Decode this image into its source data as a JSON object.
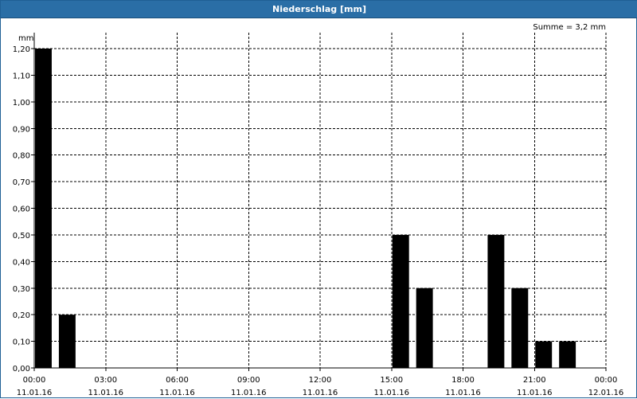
{
  "window": {
    "title": "Niederschlag [mm]"
  },
  "chart_data": {
    "type": "bar",
    "title": "Niederschlag [mm]",
    "unit_label": "mm",
    "sum_label": "Summe = 3,2 mm",
    "ylim": [
      0,
      1.2
    ],
    "y_ticks": [
      "0,00",
      "0,10",
      "0,20",
      "0,30",
      "0,40",
      "0,50",
      "0,60",
      "0,70",
      "0,80",
      "0,90",
      "1,00",
      "1,10",
      "1,20"
    ],
    "x_ticks": [
      {
        "time": "00:00",
        "date": "11.01.16"
      },
      {
        "time": "03:00",
        "date": "11.01.16"
      },
      {
        "time": "06:00",
        "date": "11.01.16"
      },
      {
        "time": "09:00",
        "date": "11.01.16"
      },
      {
        "time": "12:00",
        "date": "11.01.16"
      },
      {
        "time": "15:00",
        "date": "11.01.16"
      },
      {
        "time": "18:00",
        "date": "11.01.16"
      },
      {
        "time": "21:00",
        "date": "11.01.16"
      },
      {
        "time": "00:00",
        "date": "12.01.16"
      }
    ],
    "grid": true,
    "bar_color": "#000000",
    "bars": [
      {
        "start": "00:00",
        "end": "01:00",
        "value": 1.2
      },
      {
        "start": "01:00",
        "end": "02:00",
        "value": 0.2
      },
      {
        "start": "15:00",
        "end": "16:00",
        "value": 0.5
      },
      {
        "start": "16:00",
        "end": "17:00",
        "value": 0.3
      },
      {
        "start": "19:00",
        "end": "20:00",
        "value": 0.5
      },
      {
        "start": "20:00",
        "end": "21:00",
        "value": 0.3
      },
      {
        "start": "21:00",
        "end": "22:00",
        "value": 0.1
      },
      {
        "start": "22:00",
        "end": "23:00",
        "value": 0.1
      }
    ]
  }
}
